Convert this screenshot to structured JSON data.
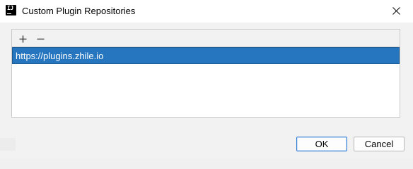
{
  "window": {
    "title": "Custom Plugin Repositories",
    "app_icon_text": "IJ",
    "close_icon": "close-icon"
  },
  "toolbar": {
    "add_icon": "plus-icon",
    "remove_icon": "minus-icon"
  },
  "repositories": [
    {
      "url": "https://plugins.zhile.io",
      "selected": true
    }
  ],
  "footer": {
    "ok_label": "OK",
    "cancel_label": "Cancel"
  },
  "colors": {
    "selection": "#2675bf",
    "window_bg": "#f2f2f2",
    "default_button_border": "#2f7ad5"
  }
}
